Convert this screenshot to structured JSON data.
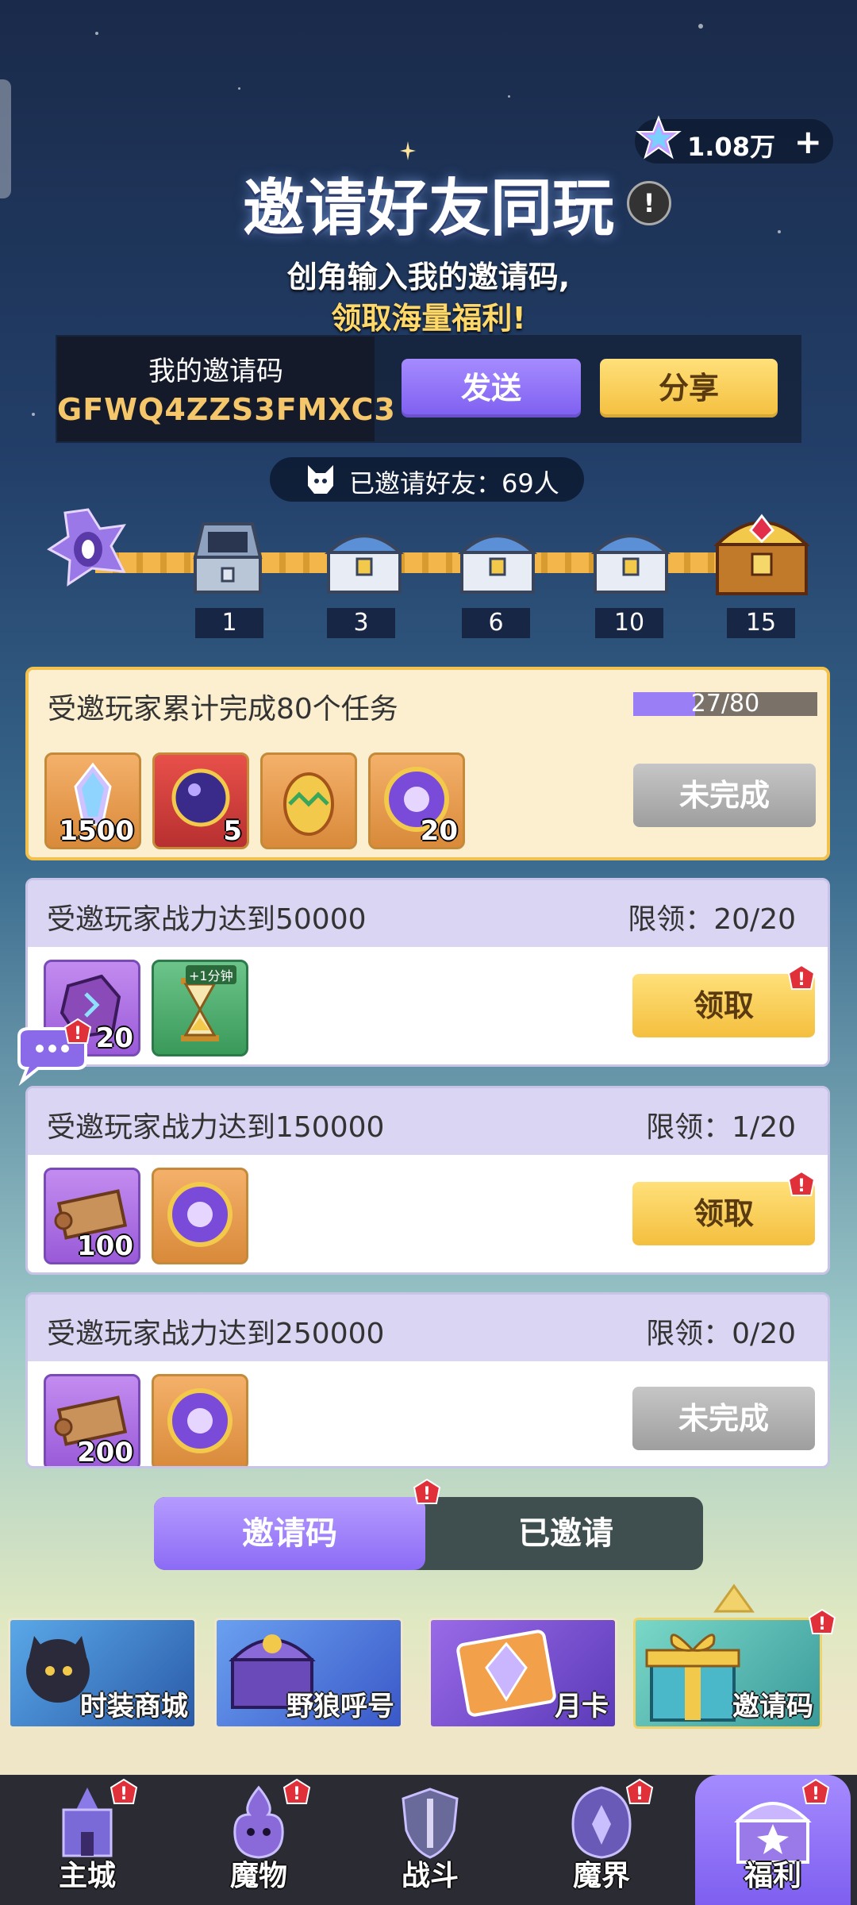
{
  "header": {
    "currency_amount": "1.08万",
    "currency_plus": "+",
    "title": "邀请好友同玩",
    "info": "!",
    "subtitle_line1": "创角输入我的邀请码,",
    "subtitle_line2": "领取海量福利!"
  },
  "invite_code": {
    "label": "我的邀请码",
    "value": "GFWQ4ZZS3FMXC3",
    "send_label": "发送",
    "share_label": "分享"
  },
  "invited_count_text": "已邀请好友：69人",
  "milestones": [
    "1",
    "3",
    "6",
    "10",
    "15"
  ],
  "tasks": [
    {
      "title": "受邀玩家累计完成80个任务",
      "progress_text": "27/80",
      "progress_fraction": 0.3375,
      "items": [
        {
          "icon": "star-crystal-icon",
          "count": "1500"
        },
        {
          "icon": "summon-orb-icon",
          "count": "5"
        },
        {
          "icon": "egg-icon",
          "count": ""
        },
        {
          "icon": "purple-coin-icon",
          "count": "20"
        }
      ],
      "button_label": "未完成"
    },
    {
      "title": "受邀玩家战力达到50000",
      "limit_text": "限领：20/20",
      "items": [
        {
          "icon": "rune-stone-icon",
          "count": "20"
        },
        {
          "icon": "hourglass-icon",
          "count": "",
          "tag": "+1分钟"
        }
      ],
      "button_label": "领取"
    },
    {
      "title": "受邀玩家战力达到150000",
      "limit_text": "限领：1/20",
      "items": [
        {
          "icon": "scroll-icon",
          "count": "100"
        },
        {
          "icon": "purple-coin-icon",
          "count": ""
        }
      ],
      "button_label": "领取"
    },
    {
      "title": "受邀玩家战力达到250000",
      "limit_text": "限领：0/20",
      "items": [
        {
          "icon": "scroll-icon",
          "count": "200"
        },
        {
          "icon": "purple-coin-icon",
          "count": ""
        }
      ],
      "button_label": "未完成"
    }
  ],
  "tabs": {
    "invite_code": "邀请码",
    "invited": "已邀请"
  },
  "shortcuts": [
    {
      "label": "时装商城"
    },
    {
      "label": "野狼呼号"
    },
    {
      "label": "月卡"
    },
    {
      "label": "邀请码"
    }
  ],
  "nav": [
    {
      "label": "主城"
    },
    {
      "label": "魔物"
    },
    {
      "label": "战斗"
    },
    {
      "label": "魔界"
    },
    {
      "label": "福利"
    }
  ],
  "colors": {
    "purple_accent": "#8c6bf5",
    "gold_button": "#f4bf3e",
    "gray_button": "#9e9e9e",
    "badge_red": "#e0303a"
  }
}
